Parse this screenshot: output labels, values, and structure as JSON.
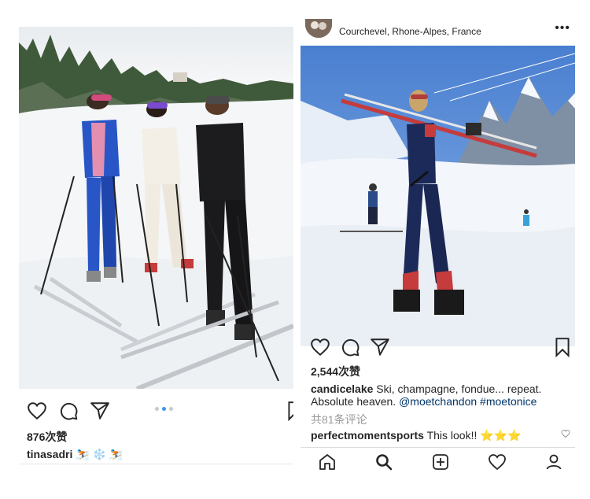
{
  "left_post": {
    "likes": "876次赞",
    "username": "tinasadri",
    "caption_emoji": "⛷️ ❄️ ⛷️",
    "carousel_dots": 3,
    "carousel_active": 2
  },
  "right_post": {
    "location": "Courchevel, Rhone-Alpes, France",
    "more_label": "•••",
    "likes": "2,544次赞",
    "username": "candicelake",
    "caption_line1": "Ski, champagne, fondue... repeat.",
    "caption_line2_text": "Absolute heaven.",
    "caption_mention": "@moetchandon",
    "caption_hashtag": "#moetonice",
    "comments_link": "共81条评论",
    "comment_user": "perfectmomentsports",
    "comment_text": "This look!!",
    "comment_emoji": "⭐⭐⭐"
  },
  "colors": {
    "text": "#262626",
    "link": "#003569",
    "muted": "#999999",
    "dot_active": "#3897f0",
    "dot_inactive": "#c8c8c8"
  },
  "icons": [
    "heart-icon",
    "comment-icon",
    "share-icon",
    "bookmark-icon",
    "home-icon",
    "search-icon",
    "add-icon",
    "activity-icon",
    "profile-icon"
  ]
}
